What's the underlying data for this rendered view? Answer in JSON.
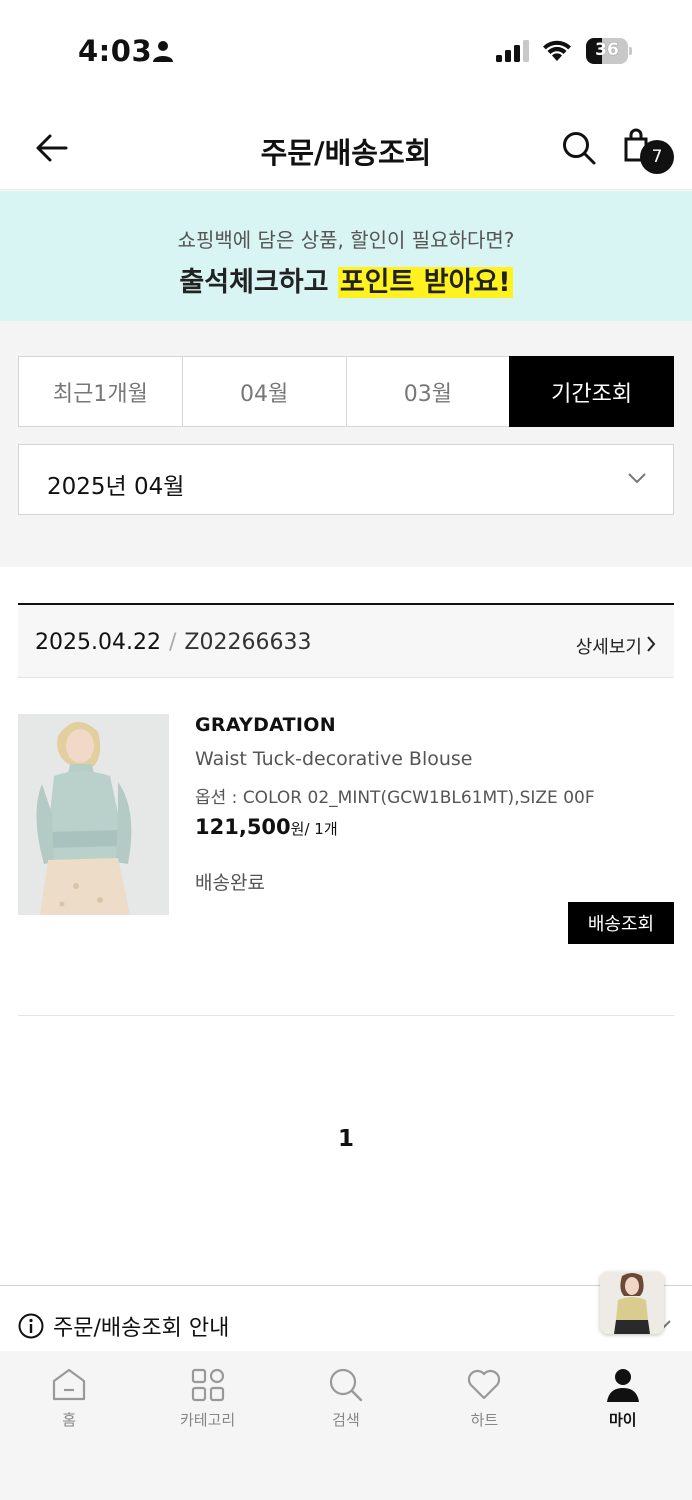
{
  "status_bar": {
    "time": "4:03",
    "battery": "36"
  },
  "header": {
    "title": "주문/배송조회",
    "cart_count": "7"
  },
  "banner": {
    "subtitle": "쇼핑백에 담은 상품, 할인이 필요하다면?",
    "title_plain": "출석체크하고 ",
    "title_highlight": "포인트 받아요!"
  },
  "period_tabs": [
    {
      "label": "최근1개월",
      "active": false
    },
    {
      "label": "04월",
      "active": false
    },
    {
      "label": "03월",
      "active": false
    },
    {
      "label": "기간조회",
      "active": true
    }
  ],
  "month_select": {
    "value": "2025년 04월"
  },
  "order": {
    "date": "2025.04.22",
    "separator": "/",
    "order_no": "Z02266633",
    "detail_link": "상세보기",
    "item": {
      "brand": "GRAYDATION",
      "name": "Waist Tuck-decorative Blouse",
      "option": "옵션 : COLOR 02_MINT(GCW1BL61MT),SIZE 00F",
      "price": "121,500",
      "price_unit": "원/ 1개",
      "status": "배송완료",
      "track_button": "배송조회"
    }
  },
  "pagination": {
    "current": "1"
  },
  "notice": {
    "label": "주문/배송조회 안내"
  },
  "bottom_nav": [
    {
      "label": "홈",
      "icon": "home-icon"
    },
    {
      "label": "카테고리",
      "icon": "category-icon"
    },
    {
      "label": "검색",
      "icon": "search-icon"
    },
    {
      "label": "하트",
      "icon": "heart-icon"
    },
    {
      "label": "마이",
      "icon": "person-icon",
      "active": true
    }
  ],
  "colors": {
    "banner_bg": "#d8f5f3",
    "highlight": "#fff21f",
    "accent": "#000000"
  }
}
